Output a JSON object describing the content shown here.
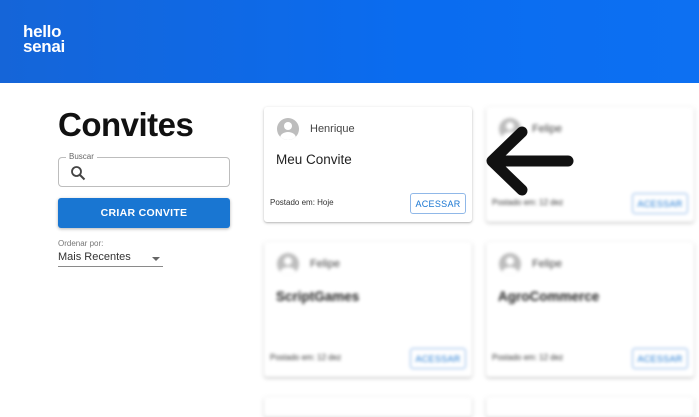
{
  "header": {
    "logo_line1": "hello",
    "logo_line2": "senai"
  },
  "sidebar": {
    "title": "Convites",
    "search_label": "Buscar",
    "search_value": "",
    "create_button": "CRIAR CONVITE",
    "order_label": "Ordenar por:",
    "order_value": "Mais Recentes"
  },
  "cards": [
    {
      "author": "Henrique",
      "title": "Meu Convite",
      "posted": "Postado em: Hoje",
      "button": "ACESSAR"
    },
    {
      "author": "Felipe",
      "title": "",
      "posted": "Postado em: 12 dez",
      "button": "ACESSAR"
    },
    {
      "author": "Felipe",
      "title": "ScriptGames",
      "posted": "Postado em: 12 dez",
      "button": "ACESSAR"
    },
    {
      "author": "Felipe",
      "title": "AgroCommerce",
      "posted": "Postado em: 12 dez",
      "button": "ACESSAR"
    }
  ],
  "colors": {
    "header": "#0a6cf0",
    "primary": "#1976d2"
  },
  "icons": [
    "search-icon",
    "avatar-icon",
    "arrow-left-icon",
    "chevron-down-icon"
  ]
}
